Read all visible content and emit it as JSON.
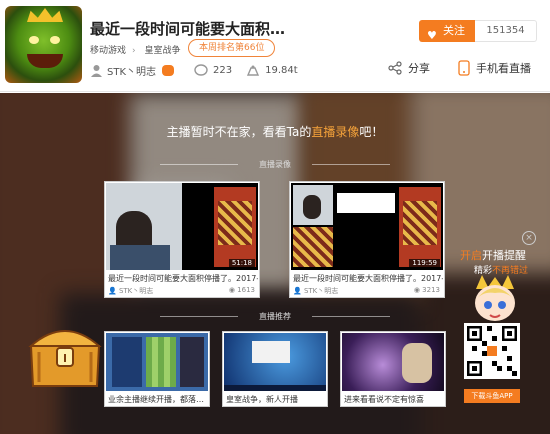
{
  "header": {
    "title": "最近一段时间可能要大面积…",
    "category": "移动游戏",
    "game": "皇室战争",
    "rank": "本周排名第66位",
    "streamer": "STK丶明志",
    "messages": "223",
    "weight": "19.84t",
    "follow_label": "关注",
    "follow_count": "151354",
    "share_label": "分享",
    "phone_label": "手机看直播",
    "accent_color": "#f47c20"
  },
  "offline": {
    "message_pre": "主播暂时不在家，看看Ta的",
    "message_link": "直播录像",
    "message_post": "吧！",
    "replays_section": "直播录像",
    "recommend_section": "直播推荐",
    "replays": [
      {
        "caption": "最近一段时间可能要大面积停播了。2017-…",
        "author": "STK丶明志",
        "views": "1613",
        "duration": "51:18"
      },
      {
        "caption": "最近一段时间可能要大面积停播了。2017-…",
        "author": "STK丶明志",
        "views": "3213",
        "duration": "119:59"
      }
    ],
    "recommends": [
      {
        "caption": "业余主播继续开播，都落…"
      },
      {
        "caption": "皇室战争，新人开播"
      },
      {
        "caption": "进来看看说不定有惊喜"
      }
    ]
  },
  "qr_panel": {
    "line1_a": "开启",
    "line1_b": "开播提醒",
    "line2_a": "精彩",
    "line2_b": "不再错过",
    "download": "下载斗鱼APP",
    "close_icon": "close-icon"
  }
}
